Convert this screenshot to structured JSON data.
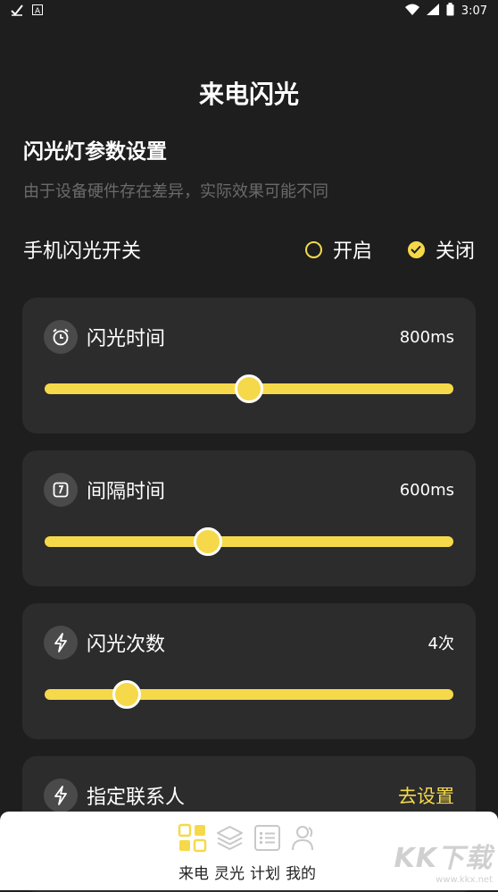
{
  "status_bar": {
    "time": "3:07",
    "left_icons": [
      "check-icon",
      "a-icon"
    ],
    "right_icons": [
      "wifi-icon",
      "signal-icon",
      "battery-icon"
    ]
  },
  "page": {
    "title": "来电闪光"
  },
  "settings": {
    "section_title": "闪光灯参数设置",
    "hint": "由于设备硬件存在差异，实际效果可能不同",
    "switch": {
      "label": "手机闪光开关",
      "options": [
        {
          "label": "开启",
          "checked": false
        },
        {
          "label": "关闭",
          "checked": true
        }
      ]
    }
  },
  "cards": [
    {
      "label": "闪光时间",
      "value": "800ms",
      "icon": "alarm-clock-icon",
      "slider_percent": 50
    },
    {
      "label": "间隔时间",
      "value": "600ms",
      "icon": "clock-icon",
      "slider_percent": 40
    },
    {
      "label": "闪光次数",
      "value": "4次",
      "icon": "lightning-icon",
      "slider_percent": 20
    },
    {
      "label": "指定联系人",
      "value": "去设置",
      "icon": "lightning-icon"
    }
  ],
  "bottom_nav": {
    "items": [
      {
        "label": "来电",
        "icon": "grid-icon",
        "active": true
      },
      {
        "label": "灵光",
        "icon": "layers-icon",
        "active": false
      },
      {
        "label": "计划",
        "icon": "list-icon",
        "active": false
      },
      {
        "label": "我的",
        "icon": "user-icon",
        "active": false
      }
    ]
  },
  "watermark": {
    "brand": "KK下载",
    "url": "www.kkx.net"
  },
  "colors": {
    "accent": "#f5d94a",
    "background": "#1e1e1e",
    "card": "#2c2c2c",
    "hint": "#6a6a6a"
  }
}
